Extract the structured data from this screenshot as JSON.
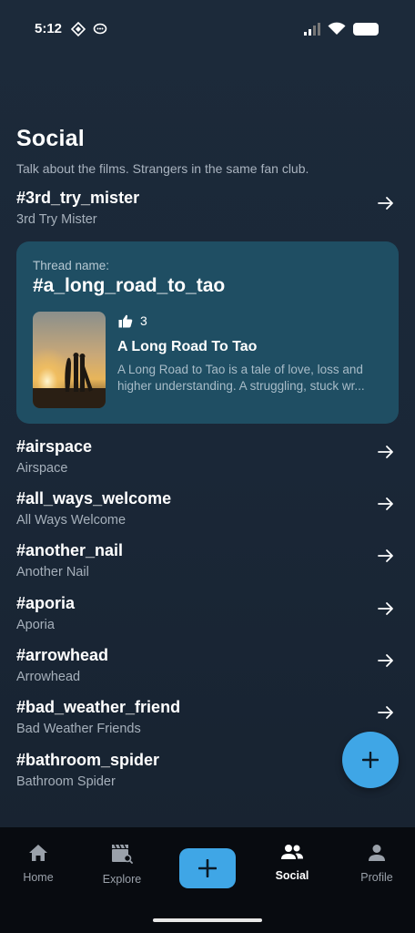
{
  "status_bar": {
    "time": "5:12"
  },
  "header": {
    "title": "Social",
    "subtitle": "Talk about the films. Strangers in the same fan club."
  },
  "threads_top": [
    {
      "tag": "#3rd_try_mister",
      "name": "3rd Try Mister"
    }
  ],
  "featured": {
    "label": "Thread name:",
    "tag": "#a_long_road_to_tao",
    "likes": "3",
    "film_title": "A Long Road To Tao",
    "desc_line1": "A Long Road to Tao is a tale of love, loss and",
    "desc_line2": "higher understanding. A struggling, stuck wr..."
  },
  "threads": [
    {
      "tag": "#airspace",
      "name": "Airspace"
    },
    {
      "tag": "#all_ways_welcome",
      "name": "All Ways Welcome"
    },
    {
      "tag": "#another_nail",
      "name": "Another Nail"
    },
    {
      "tag": "#aporia",
      "name": "Aporia"
    },
    {
      "tag": "#arrowhead",
      "name": "Arrowhead"
    },
    {
      "tag": "#bad_weather_friend",
      "name": "Bad Weather Friends"
    },
    {
      "tag": "#bathroom_spider",
      "name": "Bathroom Spider"
    }
  ],
  "nav": {
    "home": "Home",
    "explore": "Explore",
    "social": "Social",
    "profile": "Profile",
    "active": "social"
  },
  "colors": {
    "background": "#1c2a3a",
    "card": "#1f4e63",
    "accent": "#3fa6e6",
    "nav_bg": "#080b10"
  }
}
